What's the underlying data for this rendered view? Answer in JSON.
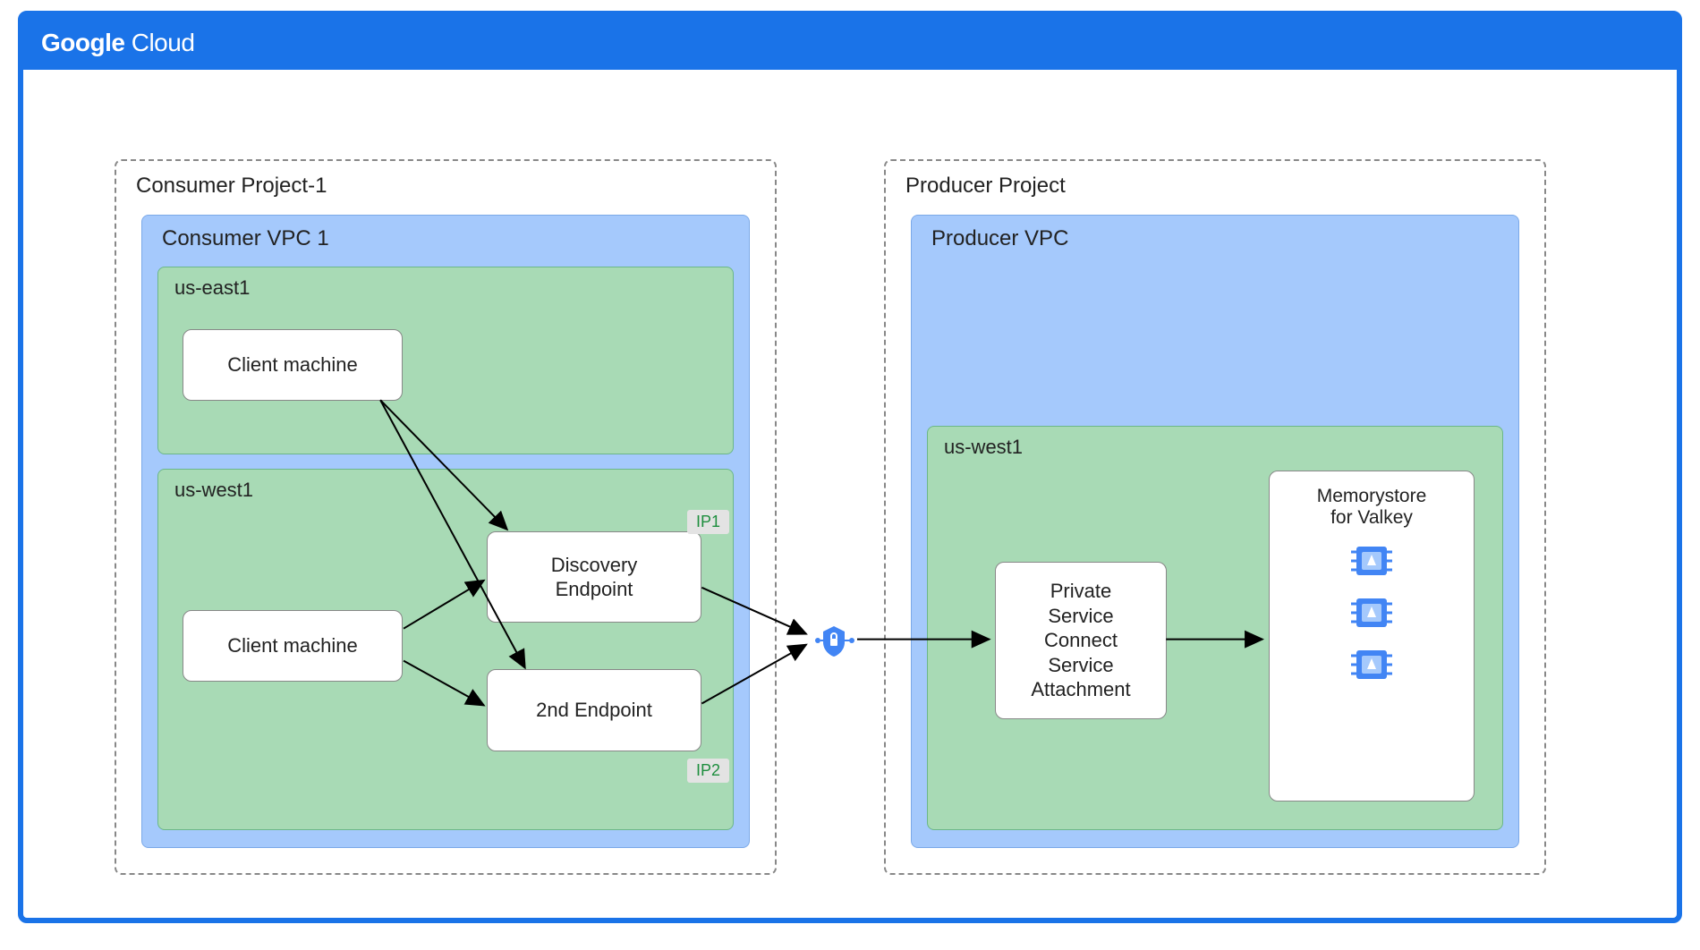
{
  "header": {
    "logo_bold": "Google",
    "logo_thin": " Cloud"
  },
  "consumer": {
    "project_label": "Consumer Project-1",
    "vpc_label": "Consumer VPC 1",
    "region1_label": "us-east1",
    "region2_label": "us-west1",
    "client1": "Client machine",
    "client2": "Client machine",
    "endpoint1": "Discovery\nEndpoint",
    "endpoint2": "2nd Endpoint",
    "ip1": "IP1",
    "ip2": "IP2"
  },
  "producer": {
    "project_label": "Producer Project",
    "vpc_label": "Producer VPC",
    "region_label": "us-west1",
    "psc_label": "Private\nService\nConnect\nService\nAttachment",
    "memorystore_label": "Memorystore\nfor Valkey"
  }
}
